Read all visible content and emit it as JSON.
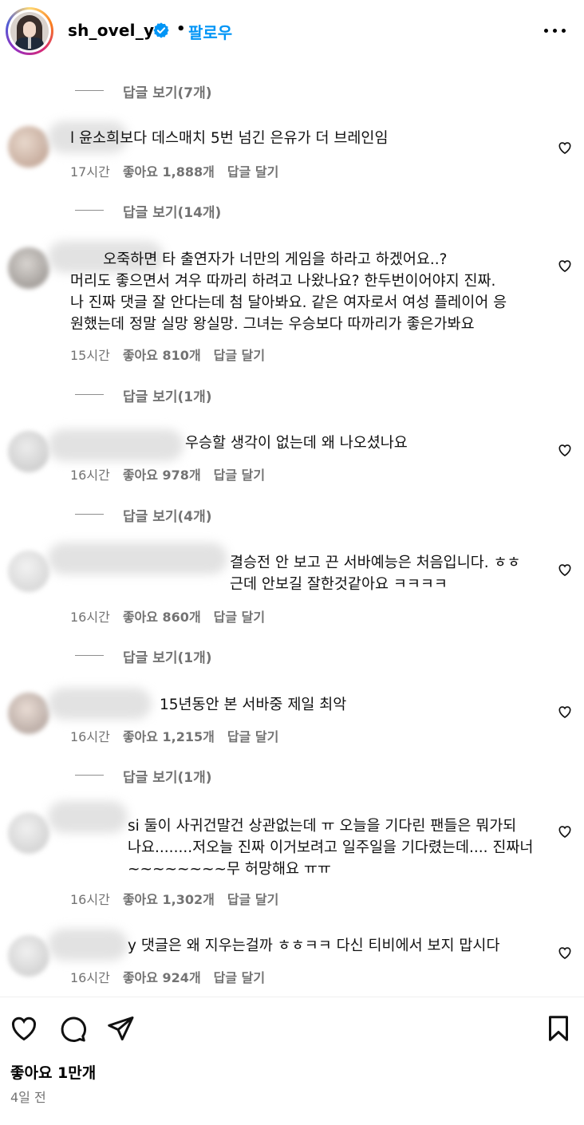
{
  "header": {
    "username": "sh_ovel_y",
    "separator": "•",
    "follow_label": "팔로우"
  },
  "comments": [
    {
      "text": "l 윤소희보다 데스매치 5번 넘긴 은유가 더 브레인임",
      "time": "17시간",
      "likes": "좋아요 1,888개",
      "reply": "답글 달기"
    },
    {
      "text": "       오죽하면 타 출연자가 너만의 게임을 하라고 하겠어요..?\n머리도 좋으면서 겨우 따까리 하려고 나왔나요? 한두번이어야지 진짜.\n나 진짜 댓글 잘 안다는데 첨 달아봐요. 같은 여자로서 여성 플레이어 응\n원했는데 정말 실망 왕실망. 그녀는 우승보다 따까리가 좋은가봐요",
      "time": "15시간",
      "likes": "좋아요 810개",
      "reply": "답글 달기"
    },
    {
      "text": "우승할 생각이 없는데 왜 나오셨나요",
      "time": "16시간",
      "likes": "좋아요 978개",
      "reply": "답글 달기"
    },
    {
      "text": "결승전 안 보고 끈 서바예능은 처음입니다. ㅎㅎ\n근데 안보길 잘한것같아요 ㅋㅋㅋㅋ",
      "time": "16시간",
      "likes": "좋아요 860개",
      "reply": "답글 달기"
    },
    {
      "text": "15년동안 본 서바중 제일 최악",
      "time": "16시간",
      "likes": "좋아요 1,215개",
      "reply": "답글 달기"
    },
    {
      "text": "si 둘이 사귀건말건 상관없는데 ㅠ 오늘을 기다린 팬들은 뭐가되\n나요........저오늘 진짜 이거보려고 일주일을 기다렸는데.... 진짜너\n~~~~~~~~무 허망해요 ㅠㅠ",
      "time": "16시간",
      "likes": "좋아요 1,302개",
      "reply": "답글 달기"
    },
    {
      "text": "y 댓글은 왜 지우는걸까 ㅎㅎㅋㅋ 다신 티비에서 보지 맙시다",
      "time": "16시간",
      "likes": "좋아요 924개",
      "reply": "답글 달기"
    }
  ],
  "reply_views": [
    "답글 보기(7개)",
    "답글 보기(14개)",
    "답글 보기(1개)",
    "답글 보기(4개)",
    "답글 보기(1개)",
    "답글 보기(1개)"
  ],
  "footer": {
    "likes": "좋아요 1만개",
    "date": "4일 전"
  },
  "colors": {
    "accent": "#0095f6",
    "verified": "#0095f6",
    "muted": "#737373"
  }
}
